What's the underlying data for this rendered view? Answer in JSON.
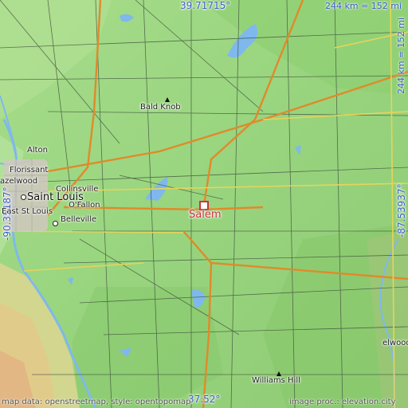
{
  "map": {
    "city": "Salem",
    "coords": {
      "top_lat": "39.71715°",
      "bottom_lat": "37.52°",
      "left_lon": "-90.35187°",
      "right_lon": "-87.53937°"
    },
    "scale": {
      "top": "244 km = 152 mi",
      "right": "244 km = 152 mi"
    },
    "places": {
      "bald_knob": "Bald Knob",
      "alton": "Alton",
      "florissant": "Florissant",
      "hazelwood": "azelwood",
      "collinsville": "Collinsville",
      "saint_louis": "Saint Louis",
      "east_st_louis": "East St Louis",
      "ofallon": "O'Fallon",
      "belleville": "Belleville",
      "williams_hill": "Williams Hill",
      "elwood": "elwood"
    },
    "attribution": {
      "left": "map data: openstreetmap, style: opentopomap",
      "right": "image proc.: elevation.city"
    },
    "colors": {
      "lowland": "#9ed884",
      "water": "#7fb8ec",
      "city_marker": "#d03040",
      "coord_text": "#3a5fc8"
    }
  }
}
